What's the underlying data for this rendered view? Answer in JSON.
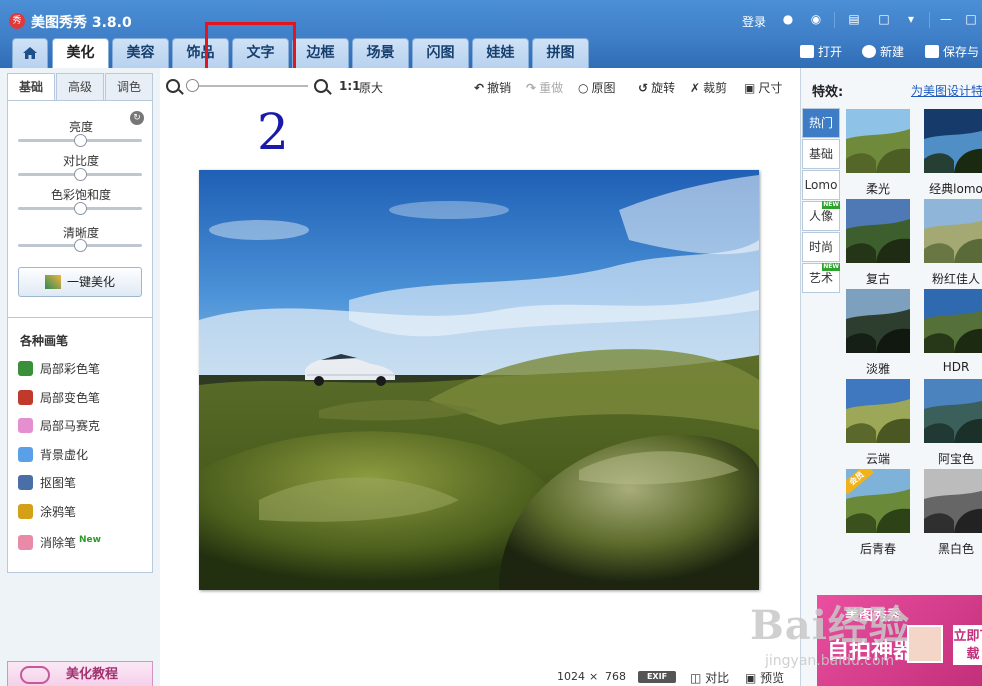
{
  "window": {
    "title": "美图秀秀 3.8.0",
    "logo_text": "秀",
    "login": "登录"
  },
  "tabs": [
    "美化",
    "美容",
    "饰品",
    "文字",
    "边框",
    "场景",
    "闪图",
    "娃娃",
    "拼图"
  ],
  "active_tab": "美化",
  "right_actions": {
    "open": "打开",
    "new": "新建",
    "save": "保存与"
  },
  "step_number": "2",
  "adjust": {
    "subtabs": [
      "基础",
      "高级",
      "调色"
    ],
    "sliders": [
      {
        "label": "亮度",
        "value": 0.5
      },
      {
        "label": "对比度",
        "value": 0.5
      },
      {
        "label": "色彩饱和度",
        "value": 0.5
      },
      {
        "label": "清晰度",
        "value": 0.5
      }
    ],
    "one_click": "一键美化"
  },
  "brushes": {
    "title": "各种画笔",
    "items": [
      {
        "label": "局部彩色笔",
        "color": "#3a8f3a"
      },
      {
        "label": "局部变色笔",
        "color": "#c0392b"
      },
      {
        "label": "局部马赛克",
        "color": "#e38fd0"
      },
      {
        "label": "背景虚化",
        "color": "#5aa0e8"
      },
      {
        "label": "抠图笔",
        "color": "#4a6fa8"
      },
      {
        "label": "涂鸦笔",
        "color": "#d4a017"
      },
      {
        "label": "消除笔",
        "color": "#e88aa8",
        "badge": "New"
      }
    ]
  },
  "tutorial": "美化教程",
  "toolbar": {
    "ratio": "1:1",
    "original_size": "原大",
    "undo": "撤销",
    "redo": "重做",
    "original": "原图",
    "rotate": "旋转",
    "crop": "裁剪",
    "resize": "尺寸"
  },
  "status": {
    "width": "1024",
    "times": "×",
    "height": "768",
    "exif": "EXIF",
    "compare": "对比",
    "preview": "预览"
  },
  "effects": {
    "title": "特效:",
    "link": "为美图设计特",
    "categories": [
      {
        "label": "热门",
        "active": true
      },
      {
        "label": "基础"
      },
      {
        "label": "Lomo"
      },
      {
        "label": "人像",
        "new": "NEW"
      },
      {
        "label": "时尚"
      },
      {
        "label": "艺术",
        "new": "NEW"
      }
    ],
    "items": [
      {
        "label": "柔光",
        "tone": "soft"
      },
      {
        "label": "经典lomo",
        "tone": "lomo"
      },
      {
        "label": "复古",
        "tone": "retro"
      },
      {
        "label": "粉红佳人",
        "tone": "pink"
      },
      {
        "label": "淡雅",
        "tone": "pale"
      },
      {
        "label": "HDR",
        "tone": "hdr"
      },
      {
        "label": "云端",
        "tone": "cloud"
      },
      {
        "label": "阿宝色",
        "tone": "abao"
      },
      {
        "label": "后青春",
        "tone": "youth",
        "badge": "会员"
      },
      {
        "label": "黑白色",
        "tone": "bw"
      }
    ]
  },
  "ad": {
    "line1": "美图秀秀",
    "line2": "自拍神器",
    "button": "立即下载"
  },
  "watermark": {
    "big": "Bai经验",
    "small": "jingyan.baidu.com"
  }
}
